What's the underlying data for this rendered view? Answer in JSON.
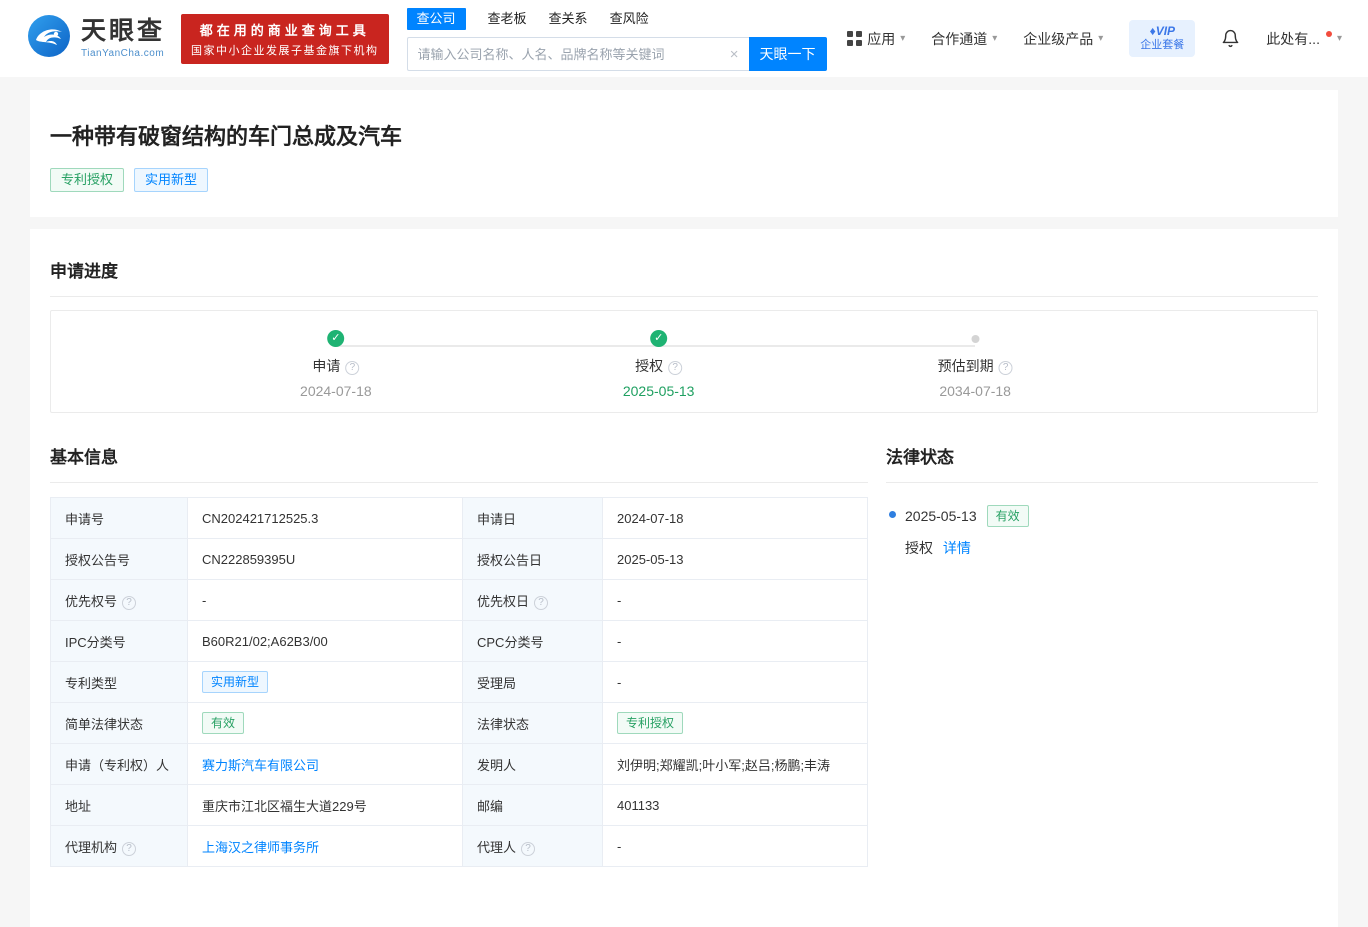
{
  "icons": {
    "check": "✓",
    "help": "?",
    "caret_down": "▾",
    "clear": "×",
    "vip_diamond": "♦"
  },
  "header": {
    "logo_text": "天眼查",
    "logo_domain": "TianYanCha.com",
    "badge_line1": "都在用的商业查询工具",
    "badge_line2": "国家中小企业发展子基金旗下机构",
    "search_tabs": [
      {
        "label": "查公司",
        "active": true
      },
      {
        "label": "查老板",
        "active": false
      },
      {
        "label": "查关系",
        "active": false
      },
      {
        "label": "查风险",
        "active": false
      }
    ],
    "search_placeholder": "请输入公司名称、人名、品牌名称等关键词",
    "search_button": "天眼一下",
    "nav_apps": "应用",
    "nav_partner": "合作通道",
    "nav_enterprise": "企业级产品",
    "vip_line1": "VIP",
    "vip_line2": "企业套餐",
    "user_name": "此处有..."
  },
  "patent": {
    "title": "一种带有破窗结构的车门总成及汽车",
    "tag_grant": "专利授权",
    "tag_type": "实用新型"
  },
  "progress": {
    "title": "申请进度",
    "steps": [
      {
        "label": "申请",
        "date": "2024-07-18",
        "state": "done"
      },
      {
        "label": "授权",
        "date": "2025-05-13",
        "state": "done"
      },
      {
        "label": "预估到期",
        "date": "2034-07-18",
        "state": "pending"
      }
    ]
  },
  "basic_info": {
    "title": "基本信息",
    "rows": [
      {
        "l1": "申请号",
        "v1": "CN202421712525.3",
        "l2": "申请日",
        "v2": "2024-07-18"
      },
      {
        "l1": "授权公告号",
        "v1": "CN222859395U",
        "l2": "授权公告日",
        "v2": "2025-05-13"
      },
      {
        "l1": "优先权号",
        "v1": "-",
        "l2": "优先权日",
        "v2": "-"
      },
      {
        "l1": "IPC分类号",
        "v1": "B60R21/02;A62B3/00",
        "l2": "CPC分类号",
        "v2": "-"
      },
      {
        "l1": "专利类型",
        "v1": "实用新型",
        "l2": "受理局",
        "v2": "-"
      },
      {
        "l1": "简单法律状态",
        "v1": "有效",
        "l2": "法律状态",
        "v2": "专利授权"
      },
      {
        "l1": "申请（专利权）人",
        "v1": "赛力斯汽车有限公司",
        "l2": "发明人",
        "v2": "刘伊明;郑耀凯;叶小军;赵吕;杨鹏;丰涛"
      },
      {
        "l1": "地址",
        "v1": "重庆市江北区福生大道229号",
        "l2": "邮编",
        "v2": "401133"
      },
      {
        "l1": "代理机构",
        "v1": "上海汉之律师事务所",
        "l2": "代理人",
        "v2": "-"
      }
    ]
  },
  "legal_status": {
    "title": "法律状态",
    "items": [
      {
        "date": "2025-05-13",
        "tag": "有效",
        "action": "授权",
        "link": "详情"
      }
    ]
  }
}
